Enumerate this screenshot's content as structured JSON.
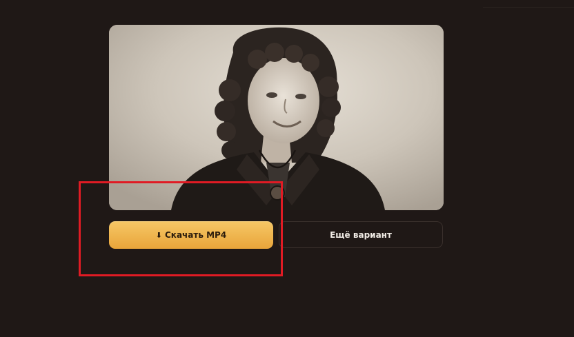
{
  "result": {
    "photo_alt": "",
    "download_icon": "download-arrow-icon",
    "download_arrow": "⬇",
    "download_label": "Скачать MP4",
    "variant_label": "Ещё вариант"
  },
  "annotation": {
    "highlight_color": "#e01b24"
  },
  "colors": {
    "background": "#1f1816",
    "accent": "#f0b04c",
    "button_text": "#2a1b0c",
    "secondary_text": "#f1ece6"
  }
}
